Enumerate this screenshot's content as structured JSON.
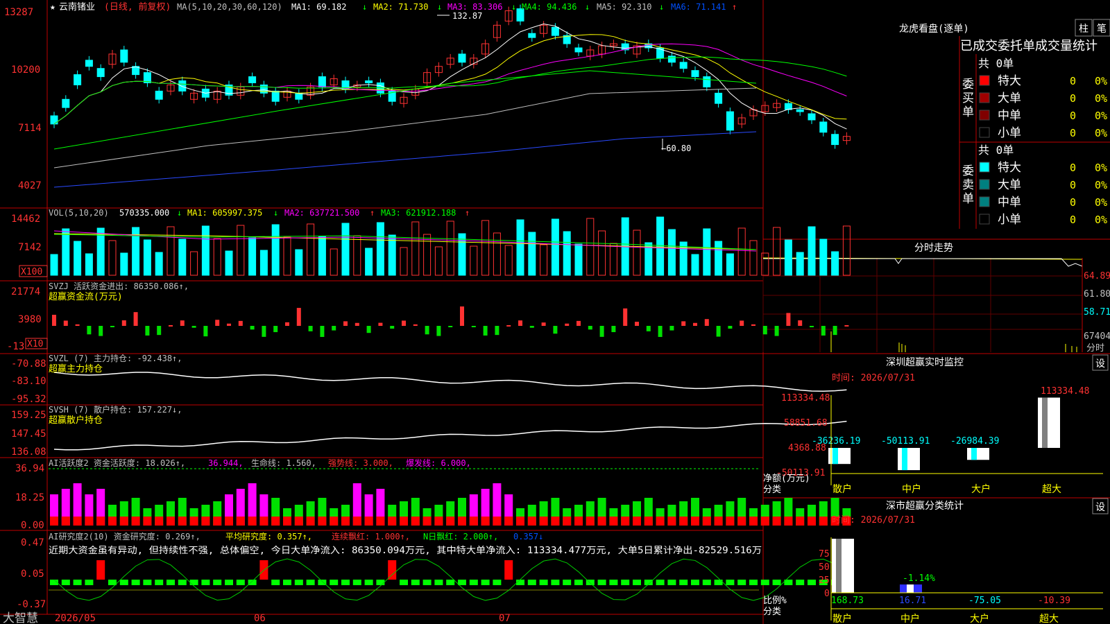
{
  "app": {
    "brand": "大智慧"
  },
  "colors": {
    "up": "#ff3232",
    "down": "#00ffff",
    "grid": "#c00000",
    "axis": "#ff3232",
    "ma1": "#ffffff",
    "ma2": "#ffff00",
    "ma3": "#ff00ff",
    "ma4": "#00ff00",
    "ma5": "#c0c0c0",
    "ma6": "#0000ff",
    "green": "#00e000",
    "magenta": "#ff00ff",
    "yellow": "#ffff00"
  },
  "price_panel": {
    "star": "★",
    "stock_name": "云南锗业",
    "period": "(日线, 前复权)",
    "ma_params": "MA(5,10,20,30,60,120)",
    "ma_values": [
      {
        "label": "MA1: 69.182",
        "arrow": "↓"
      },
      {
        "label": "MA2: 71.730",
        "arrow": "↓"
      },
      {
        "label": "MA3: 83.306",
        "arrow": "↓"
      },
      {
        "label": "MA4: 94.436",
        "arrow": "↓"
      },
      {
        "label": "MA5: 92.310",
        "arrow": "↓"
      },
      {
        "label": "MA6: 71.141",
        "arrow": "↑"
      }
    ],
    "y_ticks": [
      "13287",
      "10200",
      "7114",
      "4027"
    ],
    "high_label": "132.87",
    "low_label": "←60.80"
  },
  "vol_panel": {
    "title": "VOL(5,10,20)",
    "value": "570335.000",
    "value_arrow": "↓",
    "ma": [
      {
        "label": "MA1: 605997.375",
        "arrow": "↓"
      },
      {
        "label": "MA2: 637721.500",
        "arrow": "↑"
      },
      {
        "label": "MA3: 621912.188",
        "arrow": "↑"
      }
    ],
    "y_ticks": [
      "14462",
      "7142"
    ],
    "unit": "X100"
  },
  "svzj_panel": {
    "title": "SVZJ  活跃资金进出: 86350.086↑,",
    "subtitle": "超赢资金流(万元)",
    "y_ticks": [
      "21774",
      "3980",
      "-13"
    ],
    "unit": "X10"
  },
  "svzl_panel": {
    "title": "SVZL (7) 主力持仓: -92.438↑,",
    "subtitle": "超赢主力持仓",
    "y_ticks": [
      "-70.88",
      "-83.10",
      "-95.32"
    ]
  },
  "svsh_panel": {
    "title": "SVSH (7) 散户持仓: 157.227↓,",
    "subtitle": "超赢散户持仓",
    "y_ticks": [
      "159.25",
      "147.45",
      "136.08"
    ]
  },
  "ai_active_panel": {
    "title_white": "AI活跃度2 资金活跃度: 18.026↑,",
    "val2": "36.944,",
    "life": "生命线: 1.560,",
    "strong": "强势线: 3.000,",
    "burst": "爆发线: 6.000,",
    "y_ticks": [
      "36.94",
      "18.25",
      "0.00"
    ]
  },
  "ai_research_panel": {
    "title_white": "AI研究度2(10) 资金研究度: 0.269↑,",
    "avg": "平均研究度: 0.357↑,",
    "streak": "连续飘红: 1.000↑,",
    "nday": "N日飘红: 2.000↑,",
    "last": "0.357↓",
    "comment": "近期大资金虽有异动, 但持续性不强, 总体偏空, 今日大单净流入: 86350.094万元, 其中特大单净流入: 113334.477万元, 大单5日累计净出-82529.516万",
    "y_ticks": [
      "0.47",
      "0.05",
      "-0.37"
    ]
  },
  "x_axis": {
    "labels": [
      "2026/05",
      "06",
      "07"
    ]
  },
  "dragon_tiger": {
    "title": "龙虎看盘(逐单)",
    "btn1": "柱",
    "btn2": "笔",
    "header": "已成交委托单成交量统计",
    "buy_side": {
      "label": "委买单",
      "total": "共 0单",
      "rows": [
        {
          "name": "特大",
          "qty": "0",
          "pct": "0%",
          "color": "#ff0000"
        },
        {
          "name": "大单",
          "qty": "0",
          "pct": "0%",
          "color": "#a00000"
        },
        {
          "name": "中单",
          "qty": "0",
          "pct": "0%",
          "color": "#800000"
        },
        {
          "name": "小单",
          "qty": "0",
          "pct": "0%",
          "color": "#000000"
        }
      ]
    },
    "sell_side": {
      "label": "委卖单",
      "total": "共 0单",
      "rows": [
        {
          "name": "特大",
          "qty": "0",
          "pct": "0%",
          "color": "#00ffff"
        },
        {
          "name": "大单",
          "qty": "0",
          "pct": "0%",
          "color": "#008080"
        },
        {
          "name": "中单",
          "qty": "0",
          "pct": "0%",
          "color": "#008080"
        },
        {
          "name": "小单",
          "qty": "0",
          "pct": "0%",
          "color": "#000000"
        }
      ]
    }
  },
  "intraday": {
    "title": "分时走势",
    "y_ticks": [
      "64.89",
      "61.80",
      "58.71"
    ],
    "vol_tick": "67404",
    "vol_label": "分时"
  },
  "sz_monitor": {
    "title": "深圳超赢实时监控",
    "btn": "设",
    "date": "时间: 2026/07/31",
    "y_ticks": [
      "113334.48",
      "58851.68",
      "4368.88",
      "-50113.91"
    ],
    "top_label": "113334.48",
    "axis_title": "净额(万元)",
    "axis_sub": "分类",
    "categories": [
      "散户",
      "中户",
      "大户",
      "超大"
    ],
    "values": [
      -36236.19,
      -50113.91,
      -26984.39,
      113334.48
    ],
    "value_labels": [
      "-36236.19",
      "-50113.91",
      "-26984.39"
    ]
  },
  "sz_class": {
    "title": "深市超赢分类统计",
    "btn": "设",
    "date": "时间: 2026/07/31",
    "y_ticks": [
      "75",
      "50",
      "25",
      "0"
    ],
    "axis_title": "比例%",
    "axis_sub": "分类",
    "categories": [
      "散户",
      "中户",
      "大户",
      "超大"
    ],
    "values": [
      168.73,
      16.71,
      -75.05,
      -10.39
    ],
    "value_labels": [
      "168.73",
      "16.71",
      "-75.05",
      "-10.39"
    ],
    "mid_label": "-1.14%"
  },
  "chart_data": {
    "type": "bar",
    "title": "云南锗业 (日线, 前复权)",
    "series": [
      {
        "name": "Close",
        "values": [
          76,
          84,
          95,
          104,
          99,
          110,
          106,
          100,
          96,
          88,
          95,
          92,
          91,
          89,
          92,
          90,
          94,
          96,
          91,
          87,
          92,
          88,
          94,
          94,
          98,
          93,
          95,
          96,
          91,
          87,
          89,
          93,
          101,
          104,
          108,
          106,
          108,
          115,
          124,
          131,
          126,
          118,
          124,
          119,
          115,
          111,
          112,
          114,
          115,
          112,
          114,
          113,
          108,
          106,
          103,
          99,
          94,
          86,
          73,
          79,
          83,
          85,
          86,
          83,
          82,
          78,
          72,
          66,
          70
        ],
        "open": [
          80,
          88,
          100,
          107,
          103,
          105,
          112,
          104,
          101,
          92,
          92,
          97,
          88,
          93,
          88,
          95,
          90,
          99,
          95,
          92,
          89,
          91,
          90,
          99,
          95,
          97,
          94,
          97,
          96,
          92,
          86,
          90,
          96,
          101,
          105,
          110,
          105,
          110,
          118,
          126,
          132,
          120,
          120,
          123,
          119,
          113,
          109,
          110,
          114,
          115,
          110,
          115,
          113,
          109,
          106,
          102,
          99,
          91,
          82,
          76,
          80,
          82,
          84,
          86,
          83,
          81,
          77,
          71,
          68
        ]
      }
    ],
    "ylim": [
      40.27,
      132.87
    ]
  }
}
